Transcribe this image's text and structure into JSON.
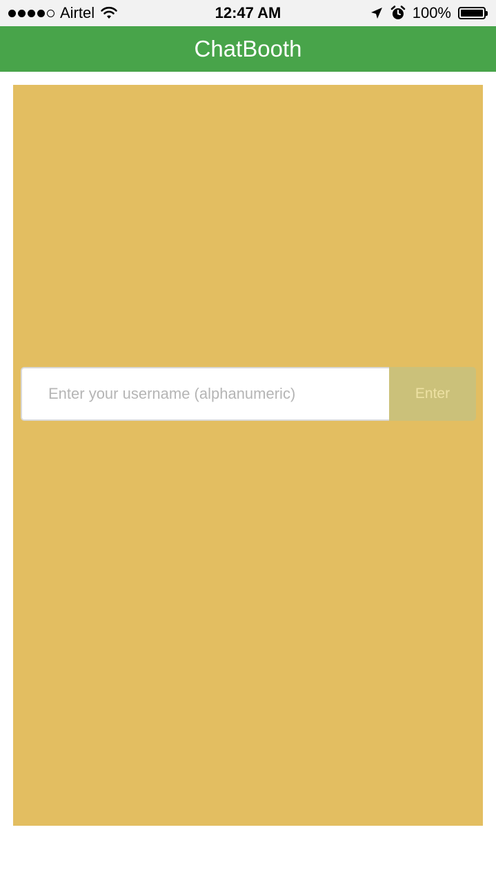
{
  "status_bar": {
    "carrier": "Airtel",
    "time": "12:47 AM",
    "battery": "100%",
    "signal_bars_filled": 4,
    "signal_bars_total": 5,
    "icons": [
      "wifi-icon",
      "location-arrow-icon",
      "alarm-clock-icon",
      "battery-icon"
    ]
  },
  "header": {
    "title": "ChatBooth"
  },
  "login": {
    "username_placeholder": "Enter your username (alphanumeric)",
    "username_value": "",
    "enter_label": "Enter"
  },
  "colors": {
    "header_bg": "#48a44a",
    "panel_bg": "#e3be61",
    "button_bg": "#cbc17a",
    "button_text": "#ede1a3"
  }
}
